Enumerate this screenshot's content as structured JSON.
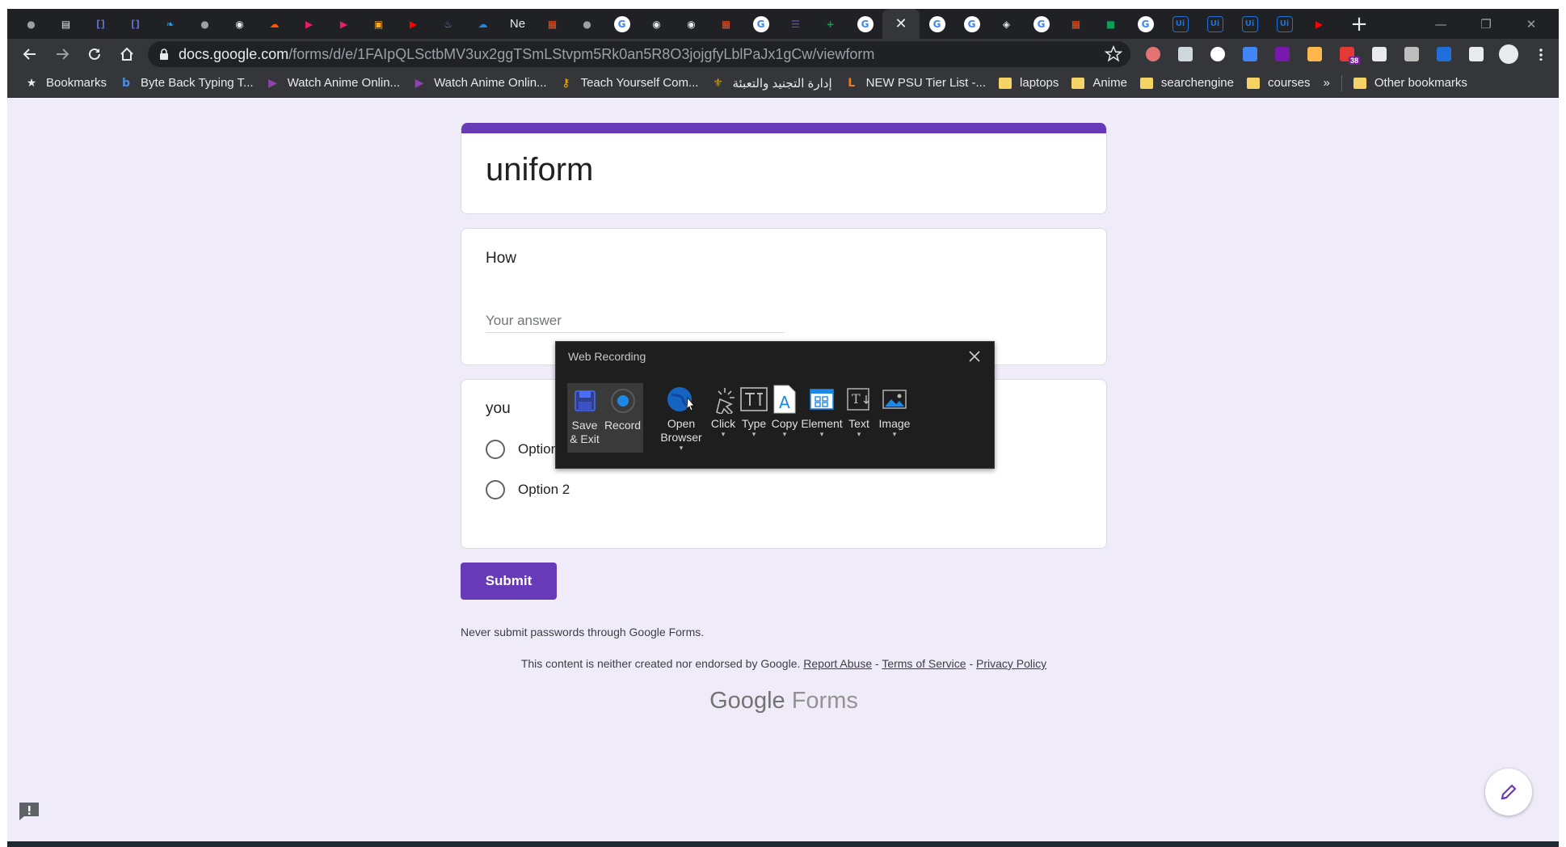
{
  "browser": {
    "tabs": [
      {
        "icon": "globe-icon",
        "color": "#9aa0a6",
        "glyph": "●"
      },
      {
        "icon": "document-icon",
        "color": "#e8eaed",
        "glyph": "▤"
      },
      {
        "icon": "bracket-icon",
        "color": "#5c6bc0",
        "glyph": "[]"
      },
      {
        "icon": "bracket-icon",
        "color": "#5c6bc0",
        "glyph": "[]"
      },
      {
        "icon": "twitter-icon",
        "color": "#1da1f2",
        "glyph": "❧"
      },
      {
        "icon": "globe-icon",
        "color": "#9aa0a6",
        "glyph": "●"
      },
      {
        "icon": "github-icon",
        "color": "#e8eaed",
        "glyph": "◉"
      },
      {
        "icon": "soundcloud-icon",
        "color": "#ff5500",
        "glyph": "☁"
      },
      {
        "icon": "play-icon",
        "color": "#e91e63",
        "glyph": "▶"
      },
      {
        "icon": "play-icon",
        "color": "#e91e63",
        "glyph": "▶"
      },
      {
        "icon": "box-icon",
        "color": "#f9a825",
        "glyph": "▣"
      },
      {
        "icon": "youtube-icon",
        "color": "#ff0000",
        "glyph": "▶"
      },
      {
        "icon": "python-icon",
        "color": "#4b8bbe",
        "glyph": "♨"
      },
      {
        "icon": "onedrive-icon",
        "color": "#1e88e5",
        "glyph": "☁"
      },
      {
        "icon": "text-tab",
        "label": "Ne"
      },
      {
        "icon": "microsoft-icon",
        "color": "#f25022",
        "glyph": "▦"
      },
      {
        "icon": "globe-icon",
        "color": "#9aa0a6",
        "glyph": "●"
      },
      {
        "icon": "google-icon",
        "color": "#ffffff",
        "glyph": "G"
      },
      {
        "icon": "github-icon",
        "color": "#e8eaed",
        "glyph": "◉"
      },
      {
        "icon": "github-icon",
        "color": "#e8eaed",
        "glyph": "◉"
      },
      {
        "icon": "microsoft-icon",
        "color": "#f25022",
        "glyph": "▦"
      },
      {
        "icon": "google-icon",
        "color": "#ffffff",
        "glyph": "G"
      },
      {
        "icon": "forms-icon",
        "color": "#7248b9",
        "glyph": "☰"
      },
      {
        "icon": "sheets-plus-icon",
        "color": "#0f9d58",
        "glyph": "+"
      },
      {
        "icon": "google-icon",
        "color": "#ffffff",
        "glyph": "G"
      },
      {
        "icon": "close-icon",
        "active": true,
        "glyph": "✕"
      },
      {
        "icon": "google-icon",
        "color": "#ffffff",
        "glyph": "G"
      },
      {
        "icon": "google-icon",
        "color": "#ffffff",
        "glyph": "G"
      },
      {
        "icon": "app-icon",
        "color": "#e8eaed",
        "glyph": "◈"
      },
      {
        "icon": "google-icon",
        "color": "#ffffff",
        "glyph": "G"
      },
      {
        "icon": "microsoft-icon",
        "color": "#f25022",
        "glyph": "▦"
      },
      {
        "icon": "sheets-icon",
        "color": "#0f9d58",
        "glyph": "■"
      },
      {
        "icon": "google-icon",
        "color": "#ffffff",
        "glyph": "G"
      },
      {
        "icon": "uipath-icon",
        "color": "#1e6fd9",
        "glyph": "Ui"
      },
      {
        "icon": "uipath-icon",
        "color": "#1e6fd9",
        "glyph": "Ui"
      },
      {
        "icon": "uipath-icon",
        "color": "#1e6fd9",
        "glyph": "Ui"
      },
      {
        "icon": "uipath-icon",
        "color": "#1e6fd9",
        "glyph": "Ui"
      },
      {
        "icon": "youtube-icon",
        "color": "#ff0000",
        "glyph": "▶"
      }
    ],
    "new_tab_glyph": "+",
    "url_host": "docs.google.com",
    "url_path": "/forms/d/e/1FAIpQLSctbMV3ux2ggTSmLStvpm5Rk0an5R8O3jojgfyLblPaJx1gCw/viewform",
    "extensions": [
      {
        "icon": "extension-eye-icon",
        "color": "#e57373"
      },
      {
        "icon": "vivaldi-v-icon",
        "color": "#cfd8dc"
      },
      {
        "icon": "circle-extension-icon",
        "color": "#ffffff"
      },
      {
        "icon": "translate-icon",
        "color": "#4285f4"
      },
      {
        "icon": "onenote-icon",
        "color": "#7719aa"
      },
      {
        "icon": "gear-extension-icon",
        "color": "#ffb74d"
      },
      {
        "icon": "badge-extension-icon",
        "color": "#e53935",
        "badge": "38"
      },
      {
        "icon": "cloud-extension-icon",
        "color": "#e8eaed"
      },
      {
        "icon": "square-extension-icon",
        "color": "#bdbdbd"
      },
      {
        "icon": "uipath-extension-icon",
        "color": "#1e6fd9"
      },
      {
        "icon": "puzzle-icon",
        "color": "#e8eaed"
      },
      {
        "icon": "avatar-icon",
        "color": "#e8eaed"
      },
      {
        "icon": "kebab-menu-icon",
        "color": "#e8eaed"
      }
    ],
    "bookmarks": [
      {
        "label": "Bookmarks",
        "icon": "star-icon"
      },
      {
        "label": "Byte Back Typing T...",
        "icon": "byteback-icon"
      },
      {
        "label": "Watch Anime Onlin...",
        "icon": "play-triangle-icon"
      },
      {
        "label": "Watch Anime Onlin...",
        "icon": "play-triangle-icon"
      },
      {
        "label": "Teach Yourself Com...",
        "icon": "key-icon"
      },
      {
        "label": "إدارة التجنيد والتعبئة",
        "icon": "emblem-icon"
      },
      {
        "label": "NEW PSU Tier List -...",
        "icon": "l-icon"
      },
      {
        "label": "laptops",
        "icon": "folder-icon"
      },
      {
        "label": "Anime",
        "icon": "folder-icon"
      },
      {
        "label": "searchengine",
        "icon": "folder-icon"
      },
      {
        "label": "courses",
        "icon": "folder-icon"
      }
    ],
    "bookmarks_more": "»",
    "other_bookmarks": "Other bookmarks"
  },
  "form": {
    "title": "uniform",
    "accent_color": "#673ab7",
    "q1": {
      "title": "How",
      "placeholder": "Your answer"
    },
    "q2": {
      "title": "you",
      "options": [
        "Option 1",
        "Option 2"
      ]
    },
    "submit_label": "Submit",
    "password_note": "Never submit passwords through Google Forms.",
    "disclaimer_text": "This content is neither created nor endorsed by Google.",
    "report_abuse": "Report Abuse",
    "sep": " - ",
    "terms": "Terms of Service",
    "privacy": "Privacy Policy",
    "logo_google": "Google",
    "logo_forms": "Forms"
  },
  "recorder": {
    "title": "Web Recording",
    "tools": [
      {
        "label": "Save\n& Exit",
        "icon": "save-icon",
        "name": "save-exit-button"
      },
      {
        "label": "Record",
        "icon": "record-icon",
        "name": "record-button"
      },
      {
        "label": "Open\nBrowser",
        "icon": "open-browser-icon",
        "name": "open-browser-button",
        "dropdown": true
      },
      {
        "label": "Click",
        "icon": "click-icon",
        "name": "click-button",
        "dropdown": true
      },
      {
        "label": "Type",
        "icon": "type-icon",
        "name": "type-button",
        "dropdown": true
      },
      {
        "label": "Copy",
        "icon": "copy-icon",
        "name": "copy-button",
        "dropdown": true
      },
      {
        "label": "Element",
        "icon": "element-icon",
        "name": "element-button",
        "dropdown": true
      },
      {
        "label": "Text",
        "icon": "text-icon",
        "name": "text-button",
        "dropdown": true
      },
      {
        "label": "Image",
        "icon": "image-icon",
        "name": "image-button",
        "dropdown": true
      }
    ]
  }
}
